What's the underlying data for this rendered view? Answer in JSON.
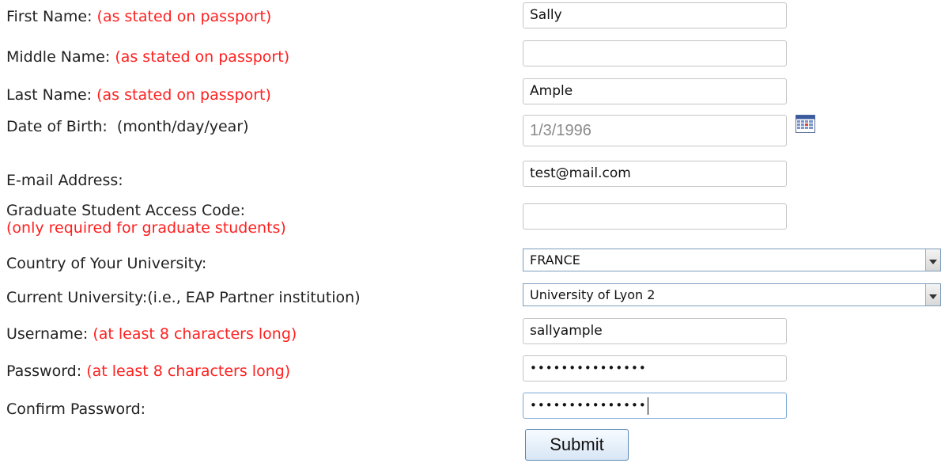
{
  "form": {
    "first_name": {
      "label": "First Name:",
      "hint": "(as stated on passport)",
      "value": "Sally"
    },
    "middle_name": {
      "label": "Middle Name:",
      "hint": "(as stated on passport)",
      "value": ""
    },
    "last_name": {
      "label": "Last Name:",
      "hint": "(as stated on passport)",
      "value": "Ample"
    },
    "dob": {
      "label": "Date of Birth:",
      "hint": "(month/day/year)",
      "value": "1/3/1996",
      "icon": "calendar-icon"
    },
    "email": {
      "label": "E-mail Address:",
      "value": "test@mail.com"
    },
    "grad_code": {
      "label": "Graduate Student Access Code:",
      "hint": "(only required for graduate students)",
      "value": ""
    },
    "country": {
      "label": "Country of Your University:",
      "value": "FRANCE"
    },
    "university": {
      "label": "Current University:(i.e., EAP Partner institution)",
      "value": "University of Lyon 2"
    },
    "username": {
      "label": "Username:",
      "hint": "(at least 8 characters long)",
      "value": "sallyample"
    },
    "password": {
      "label": "Password:",
      "hint": "(at least 8 characters long)",
      "value": "•••••••••••••••"
    },
    "confirm_password": {
      "label": "Confirm Password:",
      "value": "•••••••••••••••"
    },
    "submit_label": "Submit"
  },
  "colors": {
    "hint": "#ff2020",
    "field_border": "#c4c4c4",
    "focus_border": "#7aa7d6"
  }
}
